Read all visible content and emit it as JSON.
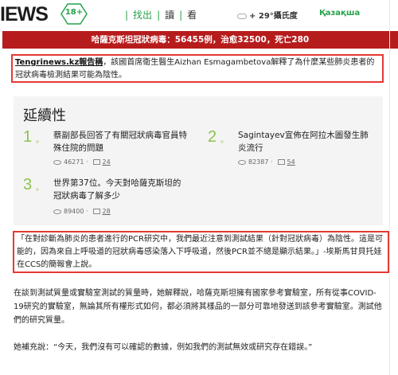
{
  "header": {
    "logo": "IEWS",
    "age_rating": "18+",
    "nav": [
      "找出",
      "讀",
      "看"
    ],
    "nav_separator": "|",
    "weather": "+ 29°攝氏度",
    "language": "Қазақша",
    "accent_color": "#27a24a"
  },
  "covid_bar": {
    "text": "哈薩克斯坦冠狀病毒：56455例，治愈32500，死亡280",
    "color": "#b71c1c"
  },
  "lead": {
    "source": "Tengrinews.kz報告稱",
    "text": "，該國首席衛生醫生Aizhan Esmagambetova解釋了為什麼某些肺炎患者的冠狀病毒檢測結果可能為陰性。"
  },
  "related": {
    "heading": "延續性",
    "items": [
      {
        "number": "1",
        "bullet": "。",
        "title": "蔡副部長回答了有關冠狀病毒官員特殊住院的問題",
        "views": "46271",
        "comments": "24"
      },
      {
        "number": "2",
        "bullet": "。",
        "title": "Sagintayev宣佈在阿拉木圖發生肺炎流行",
        "views": "82387",
        "comments": "54"
      },
      {
        "number": "3",
        "bullet": "。",
        "title": "世界第37位。今天對哈薩克斯坦的冠狀病毒了解多少",
        "views": "89400",
        "comments": "28"
      }
    ],
    "meta_separator": "·"
  },
  "quote": {
    "text": "「在對診斷為肺炎的患者進行的PCR研究中，我們最近注意到測試結果（針對冠狀病毒）為陰性。這是可能的，因為來自上呼吸道的冠狀病毒感染落入下呼吸道，然後PCR並不總是顯示結果。」-埃斯馬甘貝托娃在CCS的簡報會上說。"
  },
  "paragraphs": [
    "在談到測試質量或實驗室測試的質量時，她解釋說，哈薩克斯坦擁有國家參考實驗室，所有從事COVID-19研究的實驗室，無論其所有權形式如何，都必須將其樣品的一部分可靠地發送到該參考實驗室。測試他們的研究質量。",
    "她補充說：“今天，我們沒有可以確認的數據，例如我們的測試無效或研究存在錯誤。”"
  ],
  "icons": {
    "age": "age-badge-icon",
    "weather": "cloud-icon",
    "views": "eye-icon",
    "comments": "comment-icon"
  }
}
